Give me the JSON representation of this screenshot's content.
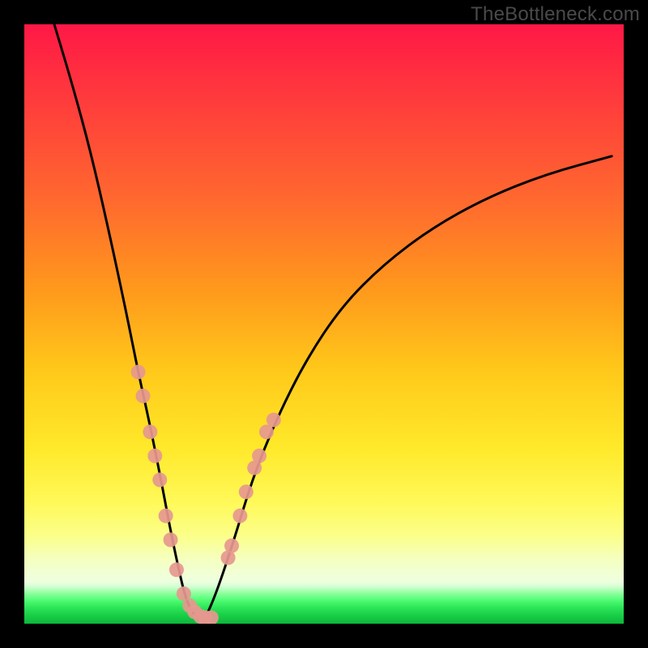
{
  "watermark": "TheBottleneck.com",
  "colors": {
    "background": "#000000",
    "curve_stroke": "#000000",
    "marker_fill": "#e6988f",
    "gradient_top": "#ff1846",
    "gradient_mid": "#ffe92a",
    "gradient_bottom": "#0cb63a"
  },
  "chart_data": {
    "type": "line",
    "title": "",
    "xlabel": "",
    "ylabel": "",
    "xlim": [
      0,
      100
    ],
    "ylim": [
      0,
      100
    ],
    "grid": false,
    "legend": false,
    "notes": "Two black curves depicting bottleneck percentage vs. a scan variable; both drop to ~0 near x≈26–30 forming a V. Salmon dots mark sampled points near the valley on each curve. Axes are unlabeled.",
    "series": [
      {
        "name": "curve-left",
        "x": [
          5,
          8,
          11,
          14,
          17,
          19,
          21,
          23,
          24.5,
          26,
          27,
          28,
          29,
          30
        ],
        "y": [
          100,
          90,
          79,
          66,
          52,
          42,
          33,
          23,
          15,
          8,
          4,
          2,
          1,
          0.5
        ]
      },
      {
        "name": "curve-right",
        "x": [
          30,
          32,
          35,
          38,
          42,
          47,
          53,
          60,
          68,
          77,
          87,
          98
        ],
        "y": [
          0.5,
          5,
          14,
          24,
          34,
          44,
          53,
          60,
          66,
          71,
          75,
          78
        ]
      }
    ],
    "markers": [
      {
        "series": "curve-left",
        "points": [
          {
            "x": 19.0,
            "y": 42
          },
          {
            "x": 19.8,
            "y": 38
          },
          {
            "x": 21.0,
            "y": 32
          },
          {
            "x": 21.8,
            "y": 28
          },
          {
            "x": 22.6,
            "y": 24
          },
          {
            "x": 23.6,
            "y": 18
          },
          {
            "x": 24.4,
            "y": 14
          },
          {
            "x": 25.4,
            "y": 9
          },
          {
            "x": 26.6,
            "y": 5
          },
          {
            "x": 27.6,
            "y": 3
          },
          {
            "x": 28.4,
            "y": 2
          },
          {
            "x": 29.4,
            "y": 1.2
          },
          {
            "x": 30.2,
            "y": 1.0
          },
          {
            "x": 31.2,
            "y": 1.0
          }
        ]
      },
      {
        "series": "curve-right",
        "points": [
          {
            "x": 34.0,
            "y": 11
          },
          {
            "x": 34.6,
            "y": 13
          },
          {
            "x": 36.0,
            "y": 18
          },
          {
            "x": 37.0,
            "y": 22
          },
          {
            "x": 38.4,
            "y": 26
          },
          {
            "x": 39.2,
            "y": 28
          },
          {
            "x": 40.4,
            "y": 32
          },
          {
            "x": 41.6,
            "y": 34
          }
        ]
      }
    ]
  }
}
